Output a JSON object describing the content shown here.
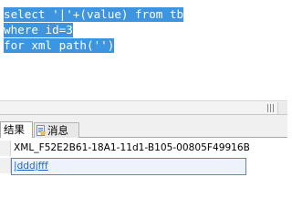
{
  "editor": {
    "lines": [
      "select '|'+(value) from tb",
      "where id=3",
      "for xml path('')"
    ],
    "selection_color": "#3d95e0"
  },
  "results": {
    "tabs": [
      {
        "label": "结果",
        "icon": "grid-icon",
        "active": true
      },
      {
        "label": "消息",
        "icon": "message-icon",
        "active": false
      }
    ],
    "column_header": "XML_F52E2B61-18A1-11d1-B105-00805F49916B",
    "rows": [
      {
        "value": "|dddjfff"
      }
    ],
    "link_color": "#1f5fd8"
  }
}
